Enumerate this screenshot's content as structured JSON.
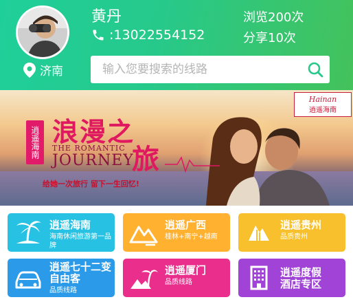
{
  "profile": {
    "name": "黄丹",
    "phone": ":13022554152",
    "views": "浏览200次",
    "shares": "分享10次"
  },
  "location": {
    "city": "济南"
  },
  "search": {
    "placeholder": "输入您要搜索的线路"
  },
  "banner": {
    "badge": "逍遥海南",
    "title_romance": "浪漫之",
    "title_travel": "旅",
    "subtitle_en_1": "THE ROMANTIC",
    "subtitle_en_2": "JOURNEY",
    "slogan": "给她一次旅行  留下一生回忆!",
    "logo_script": "Hainan",
    "logo_text": "逍遥海南"
  },
  "tiles": [
    {
      "title": "逍遥海南",
      "sub": "海南休闲旅游第一品牌",
      "sub2": "",
      "icon": "palm-island-icon",
      "color": "#27c2e3"
    },
    {
      "title": "逍遥广西",
      "sub": "桂林+南宁+越南",
      "sub2": "",
      "icon": "mountain-icon",
      "color": "#ffb12f"
    },
    {
      "title": "逍遥贵州",
      "sub": "品质贵州",
      "sub2": "",
      "icon": "waterfall-icon",
      "color": "#f7c02c"
    },
    {
      "title": "逍遥七十二变",
      "title2": "自由客",
      "sub": "品质线路",
      "icon": "car-icon",
      "color": "#2b9be9"
    },
    {
      "title": "逍遥厦门",
      "sub": "品质线路",
      "icon": "palm-island-icon",
      "color": "#ea2e8c"
    },
    {
      "title": "逍遥度假",
      "title2": "酒店专区",
      "icon": "hotel-icon",
      "color": "#a043d6"
    }
  ],
  "colors": {
    "header_start": "#1fcf9a",
    "header_end": "#44c25b",
    "search_icon": "#27c98a",
    "banner_accent": "#e01860"
  }
}
